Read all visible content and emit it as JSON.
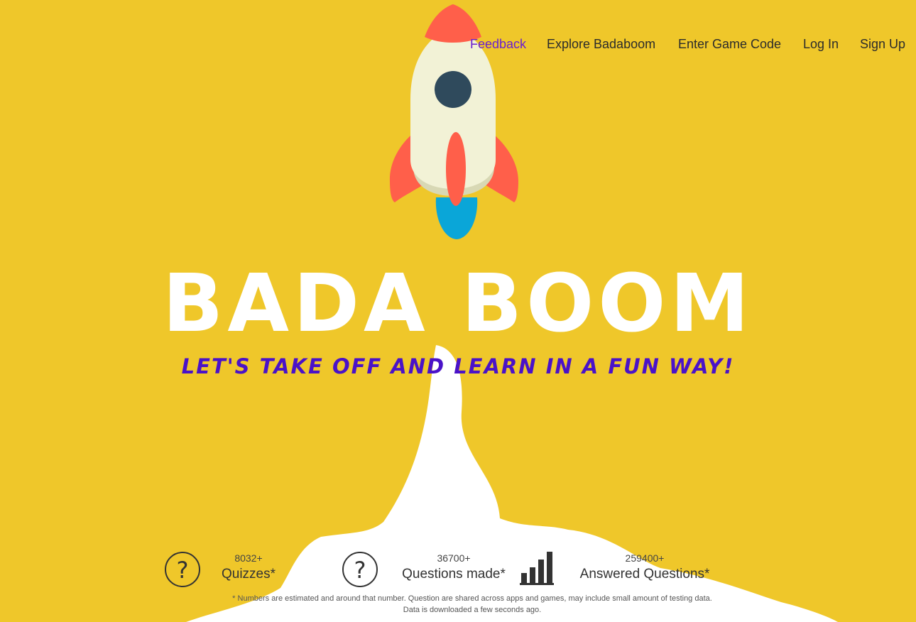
{
  "nav": {
    "items": [
      {
        "label": "Feedback",
        "active": true
      },
      {
        "label": "Explore Badaboom"
      },
      {
        "label": "Enter Game Code"
      },
      {
        "label": "Log In"
      },
      {
        "label": "Sign Up"
      }
    ]
  },
  "hero": {
    "title": "BADA BOOM",
    "tagline": "LET'S TAKE OFF AND LEARN IN A FUN WAY!"
  },
  "stats": [
    {
      "count": "8032+",
      "label": "Quizzes*",
      "icon": "question-circle-icon"
    },
    {
      "count": "36700+",
      "label": "Questions made*",
      "icon": "question-circle-icon"
    },
    {
      "count": "259400+",
      "label": "Answered Questions*",
      "icon": "bar-chart-icon"
    }
  ],
  "footnote": {
    "line1": "* Numbers are estimated and around that number. Question are shared across apps and games, may include small amount of testing data.",
    "line2": "Data is downloaded a few seconds ago."
  },
  "colors": {
    "background": "#efc72a",
    "accent_purple": "#4a12c8",
    "nav_active": "#6a1fd0",
    "rocket_red": "#ff5f4a",
    "rocket_body": "#f2f2d6",
    "rocket_window": "#2f4a5c",
    "flame_blue": "#0aa6d8"
  }
}
